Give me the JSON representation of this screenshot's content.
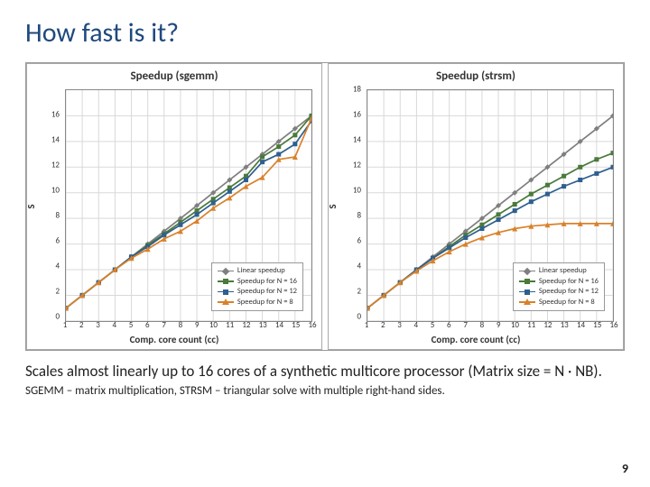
{
  "title": "How fast is it?",
  "body1": "Scales almost linearly up to 16 cores of a synthetic multicore processor (Matrix size = N · NB).",
  "body2": "SGEMM – matrix multiplication, STRSM – triangular solve with multiple right-hand sides.",
  "pagenum": "9",
  "legend": {
    "lin": "Linear speedup",
    "n16": "Speedup for N = 16",
    "n12": "Speedup for N = 12",
    "n8": "Speedup for N = 8"
  },
  "colors": {
    "lin": "#7f7f7f",
    "n16": "#4a7a3a",
    "n12": "#2f5f8f",
    "n8": "#d9822b"
  },
  "chart_data": [
    {
      "type": "line",
      "title": "Speedup (sgemm)",
      "xlabel": "Comp. core count (cc)",
      "ylabel": "S",
      "x": [
        1,
        2,
        3,
        4,
        5,
        6,
        7,
        8,
        9,
        10,
        11,
        12,
        13,
        14,
        15,
        16
      ],
      "ylim": [
        0,
        18
      ],
      "yticks": [
        0,
        2,
        4,
        6,
        8,
        10,
        12,
        14,
        16
      ],
      "series": [
        {
          "name": "Linear speedup",
          "key": "lin",
          "marker": "d",
          "values": [
            1,
            2,
            3,
            4,
            5,
            6,
            7,
            8,
            9,
            10,
            11,
            12,
            13,
            14,
            15,
            16
          ]
        },
        {
          "name": "Speedup for N = 16",
          "key": "n16",
          "marker": "s",
          "values": [
            1,
            2,
            3,
            4,
            5,
            5.9,
            6.8,
            7.7,
            8.6,
            9.5,
            10.4,
            11.3,
            12.8,
            13.6,
            14.5,
            16
          ]
        },
        {
          "name": "Speedup for N = 12",
          "key": "n12",
          "marker": "s",
          "values": [
            1,
            2,
            3,
            4,
            5,
            5.8,
            6.7,
            7.5,
            8.3,
            9.2,
            10.1,
            11,
            12.4,
            13,
            13.8,
            15.6
          ]
        },
        {
          "name": "Speedup for N = 8",
          "key": "n8",
          "marker": "t",
          "values": [
            1,
            2,
            3,
            4,
            4.9,
            5.6,
            6.4,
            7,
            7.8,
            8.8,
            9.6,
            10.5,
            11.2,
            12.6,
            12.8,
            15.8
          ]
        }
      ]
    },
    {
      "type": "line",
      "title": "Speedup (strsm)",
      "xlabel": "Comp. core count (cc)",
      "ylabel": "S",
      "x": [
        1,
        2,
        3,
        4,
        5,
        6,
        7,
        8,
        9,
        10,
        11,
        12,
        13,
        14,
        15,
        16
      ],
      "ylim": [
        0,
        18
      ],
      "yticks": [
        0,
        2,
        4,
        6,
        8,
        10,
        12,
        14,
        16,
        18
      ],
      "series": [
        {
          "name": "Linear speedup",
          "key": "lin",
          "marker": "d",
          "values": [
            1,
            2,
            3,
            4,
            5,
            6,
            7,
            8,
            9,
            10,
            11,
            12,
            13,
            14,
            15,
            16
          ]
        },
        {
          "name": "Speedup for N = 16",
          "key": "n16",
          "marker": "s",
          "values": [
            1,
            2,
            3,
            4,
            4.9,
            5.8,
            6.7,
            7.5,
            8.3,
            9.1,
            9.9,
            10.6,
            11.3,
            12,
            12.6,
            13.1
          ]
        },
        {
          "name": "Speedup for N = 12",
          "key": "n12",
          "marker": "s",
          "values": [
            1,
            2,
            3,
            4,
            4.9,
            5.7,
            6.5,
            7.2,
            7.9,
            8.6,
            9.3,
            9.9,
            10.5,
            11,
            11.5,
            12
          ]
        },
        {
          "name": "Speedup for N = 8",
          "key": "n8",
          "marker": "t",
          "values": [
            1,
            2,
            3,
            3.9,
            4.7,
            5.4,
            6,
            6.5,
            6.9,
            7.2,
            7.4,
            7.5,
            7.6,
            7.6,
            7.6,
            7.6
          ]
        }
      ]
    }
  ]
}
